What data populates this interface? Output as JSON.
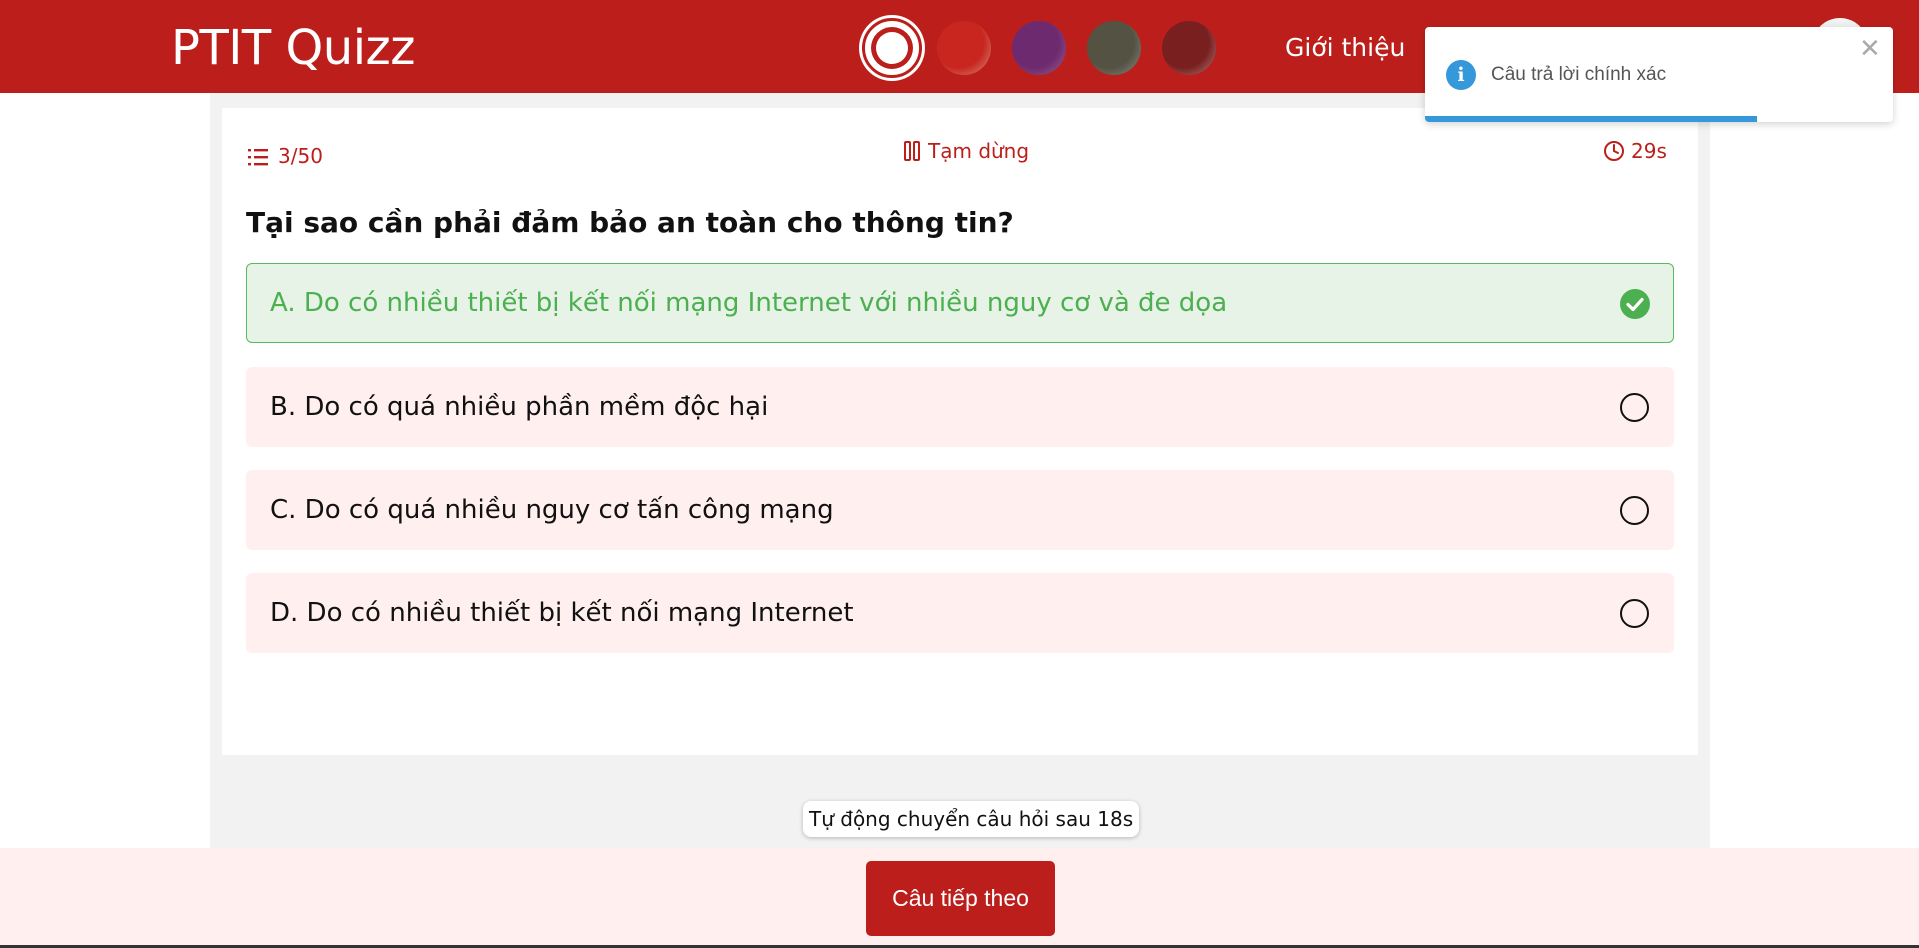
{
  "header": {
    "brand": "PTIT Quizz",
    "nav_about": "Giới thiệu",
    "theme_colors": [
      "#ffffff",
      "#c8261f",
      "#6e2a6e",
      "#545242",
      "#7a1f1f"
    ],
    "accent": "#bc1f1b"
  },
  "toast": {
    "icon": "info-icon",
    "message": "Câu trả lời chính xác",
    "close_icon": "close-icon",
    "progress": 0.71
  },
  "quiz": {
    "counter": "3/50",
    "pause_label": "Tạm dừng",
    "timer": "29s",
    "question": "Tại sao cần phải đảm bảo an toàn cho thông tin?",
    "options": [
      {
        "label": "A. Do có nhiều thiết bị kết nối mạng Internet với nhiều nguy cơ và đe dọa",
        "state": "correct"
      },
      {
        "label": "B. Do có quá nhiều phần mềm độc hại",
        "state": "unselected"
      },
      {
        "label": "C. Do có quá nhiều nguy cơ tấn công mạng",
        "state": "unselected"
      },
      {
        "label": "D. Do có nhiều thiết bị kết nối mạng Internet",
        "state": "unselected"
      }
    ],
    "auto_next": "Tự động chuyển câu hỏi sau 18s",
    "next_button": "Câu tiếp theo"
  }
}
